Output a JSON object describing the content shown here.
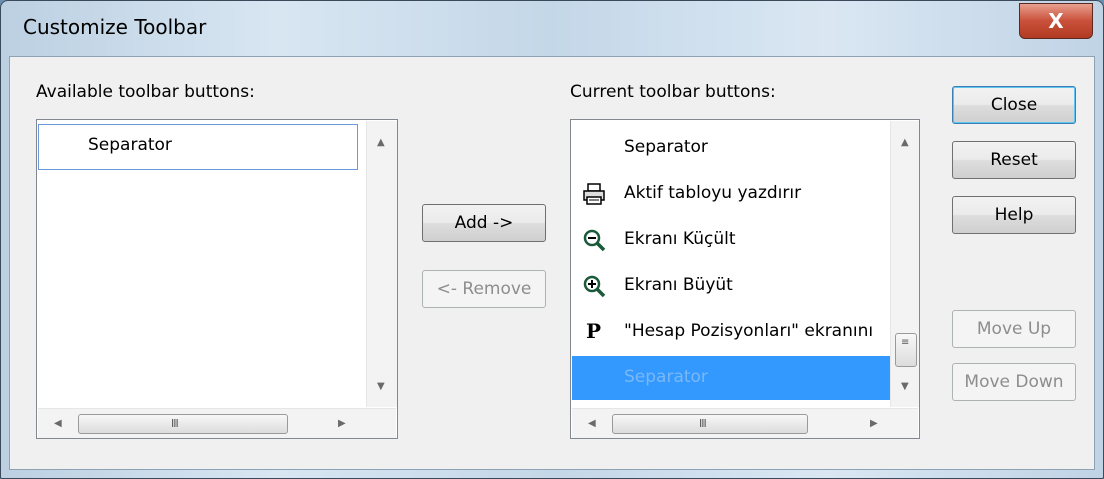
{
  "window": {
    "title": "Customize Toolbar",
    "close_glyph": "X"
  },
  "available": {
    "label": "Available toolbar buttons:",
    "items": [
      {
        "label": "Separator"
      }
    ],
    "scroll_grip": "III"
  },
  "current": {
    "label": "Current toolbar buttons:",
    "items": [
      {
        "label": "Separator",
        "icon": "none"
      },
      {
        "label": "Aktif tabloyu yazdırır",
        "icon": "printer-icon"
      },
      {
        "label": "Ekranı Küçült",
        "icon": "zoom-out-icon"
      },
      {
        "label": "Ekranı Büyüt",
        "icon": "zoom-in-icon"
      },
      {
        "label": "\"Hesap Pozisyonları\" ekranını",
        "icon": "bold-p-icon",
        "icon_text": "P"
      },
      {
        "label": "Separator",
        "icon": "none",
        "selected": true
      }
    ],
    "scroll_grip": "III"
  },
  "buttons": {
    "add": "Add ->",
    "remove": "<- Remove",
    "close": "Close",
    "reset": "Reset",
    "help": "Help",
    "move_up": "Move Up",
    "move_down": "Move Down"
  },
  "colors": {
    "selection": "#3399ff",
    "close_button": "#c9503a",
    "focus_border": "#3c7fb1"
  }
}
